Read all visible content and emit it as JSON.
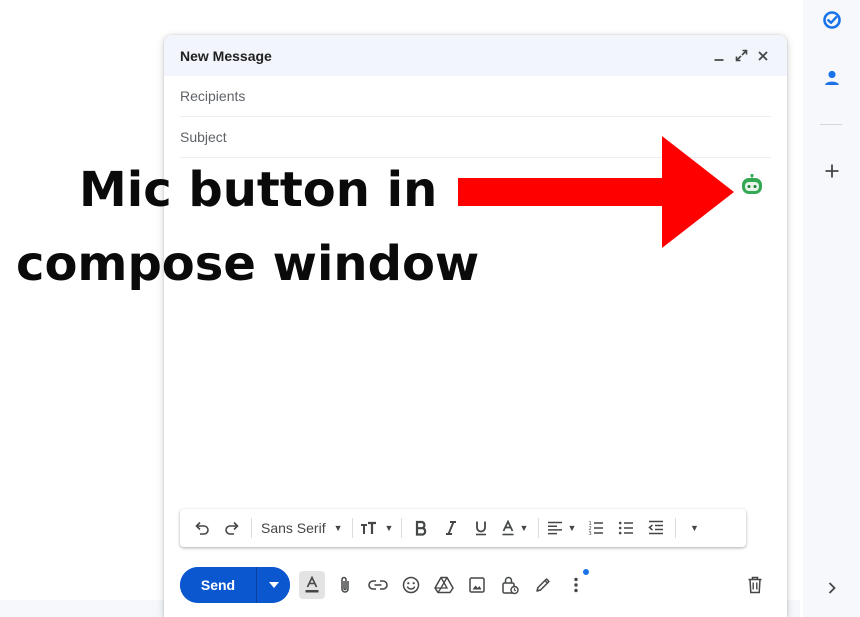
{
  "compose": {
    "title": "New Message",
    "recipients_placeholder": "Recipients",
    "subject_placeholder": "Subject"
  },
  "annotation": {
    "line1": "Mic button in",
    "line2": "compose window",
    "arrow_color": "#ff0000"
  },
  "toolbar": {
    "font": "Sans Serif"
  },
  "actions": {
    "send_label": "Send"
  },
  "colors": {
    "send_blue": "#0b57d0",
    "mic_green": "#34a853",
    "side_blue": "#1a73e8"
  },
  "icons": {
    "header": [
      "minimize-icon",
      "expand-icon",
      "close-icon"
    ],
    "formatting": [
      "undo-icon",
      "redo-icon",
      "text-size-icon",
      "bold-icon",
      "italic-icon",
      "underline-icon",
      "text-color-icon",
      "align-icon",
      "numbered-list-icon",
      "bulleted-list-icon",
      "indent-less-icon",
      "more-formatting-icon"
    ],
    "bottom": [
      "formatting-options-icon",
      "attach-icon",
      "link-icon",
      "emoji-icon",
      "drive-icon",
      "photo-icon",
      "confidential-icon",
      "signature-icon",
      "more-options-icon",
      "discard-icon"
    ],
    "side": [
      "tasks-icon",
      "contacts-icon",
      "add-icon",
      "expand-panel-icon"
    ],
    "mic": "mic-robot-icon"
  }
}
